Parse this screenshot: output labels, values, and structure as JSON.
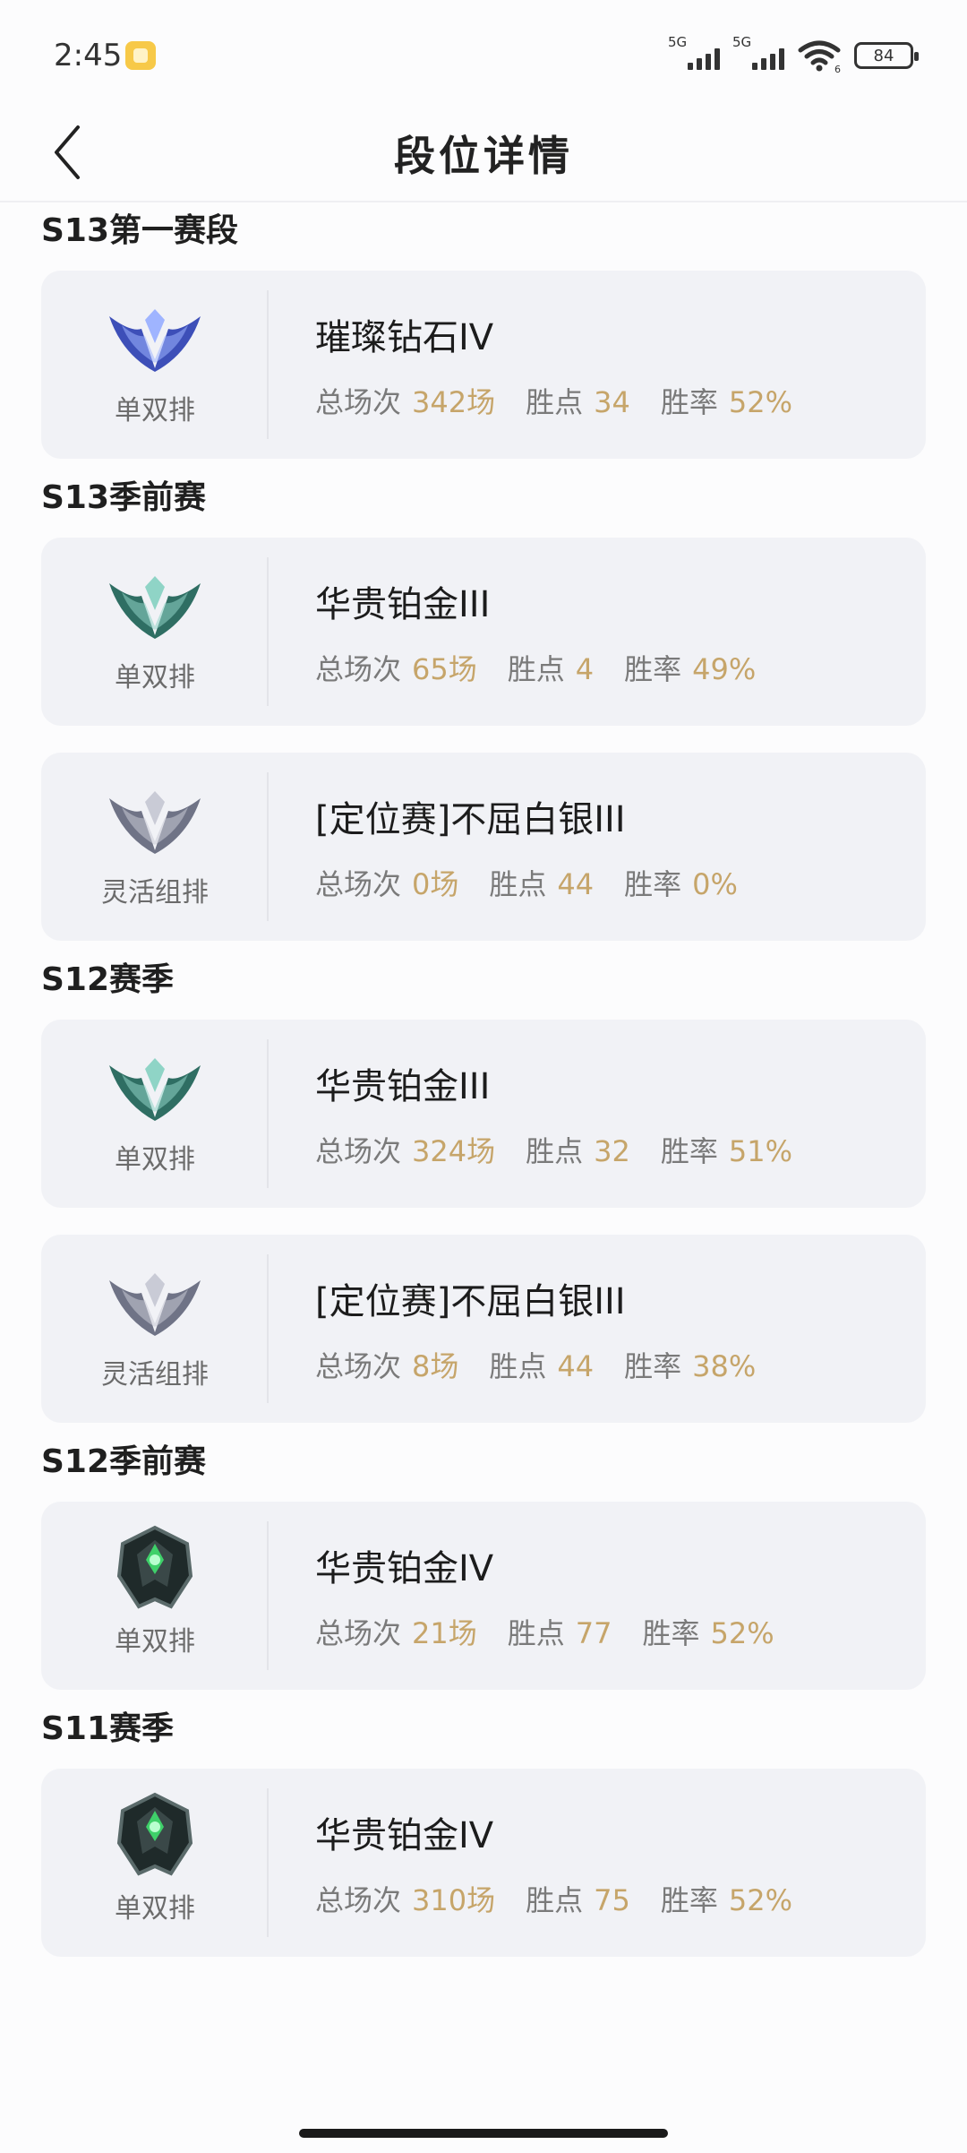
{
  "status_bar": {
    "time": "2:45",
    "signal_label_1": "5G",
    "signal_label_2": "5G",
    "wifi_sub": "6",
    "battery": "84"
  },
  "header": {
    "title": "段位详情"
  },
  "stat_labels": {
    "games": "总场次",
    "points": "胜点",
    "winrate": "胜率"
  },
  "sections": [
    {
      "title": "S13第一赛段",
      "entries": [
        {
          "queue": "单双排",
          "rank": "璀璨钻石IV",
          "games": "342场",
          "points": "34",
          "winrate": "52%",
          "emblem": "diamond-emblem-icon",
          "emblem_color": "#3d4fb8"
        }
      ]
    },
    {
      "title": "S13季前赛",
      "entries": [
        {
          "queue": "单双排",
          "rank": "华贵铂金III",
          "games": "65场",
          "points": "4",
          "winrate": "49%",
          "emblem": "platinum-emblem-icon",
          "emblem_color": "#2f6e63"
        },
        {
          "queue": "灵活组排",
          "rank": "[定位赛]不屈白银III",
          "games": "0场",
          "points": "44",
          "winrate": "0%",
          "emblem": "silver-emblem-icon",
          "emblem_color": "#6f7386"
        }
      ]
    },
    {
      "title": "S12赛季",
      "entries": [
        {
          "queue": "单双排",
          "rank": "华贵铂金III",
          "games": "324场",
          "points": "32",
          "winrate": "51%",
          "emblem": "platinum-emblem-icon",
          "emblem_color": "#2f6e63"
        },
        {
          "queue": "灵活组排",
          "rank": "[定位赛]不屈白银III",
          "games": "8场",
          "points": "44",
          "winrate": "38%",
          "emblem": "silver-emblem-icon",
          "emblem_color": "#6f7386"
        }
      ]
    },
    {
      "title": "S12季前赛",
      "entries": [
        {
          "queue": "单双排",
          "rank": "华贵铂金IV",
          "games": "21场",
          "points": "77",
          "winrate": "52%",
          "emblem": "platinum-crest-emblem-icon",
          "emblem_color": "#1f2a2a"
        }
      ]
    },
    {
      "title": "S11赛季",
      "entries": [
        {
          "queue": "单双排",
          "rank": "华贵铂金IV",
          "games": "310场",
          "points": "75",
          "winrate": "52%",
          "emblem": "platinum-crest-emblem-icon",
          "emblem_color": "#1f2a2a"
        }
      ]
    }
  ]
}
